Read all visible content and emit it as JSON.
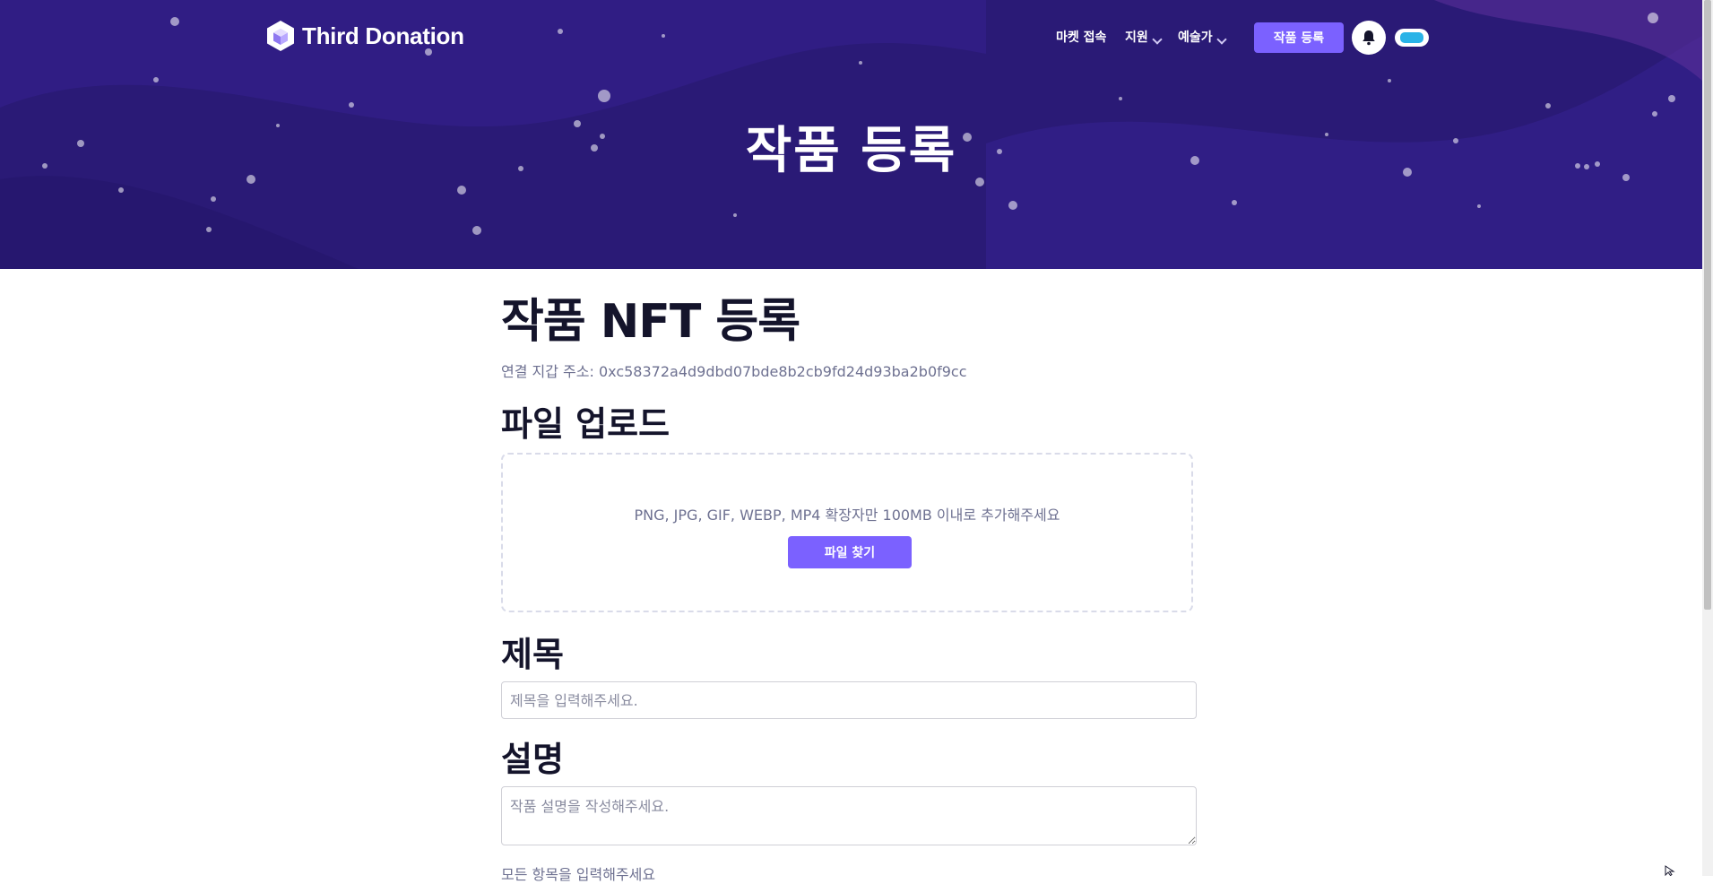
{
  "brand": {
    "name": "Third Donation"
  },
  "nav": {
    "items": [
      {
        "label": "마켓 접속",
        "dropdown": false
      },
      {
        "label": "지원",
        "dropdown": true
      },
      {
        "label": "예술가",
        "dropdown": true
      }
    ],
    "register_button": "작품 등록",
    "bell_icon": "bell-icon",
    "avatar_icon": "user-avatar-icon"
  },
  "hero": {
    "title": "작품 등록"
  },
  "form": {
    "page_title": "작품 NFT 등록",
    "wallet_label": "연결 지갑 주소: 0xc58372a4d9dbd07bde8b2cb9fd24d93ba2b0f9cc",
    "upload": {
      "title": "파일 업로드",
      "hint": "PNG, JPG, GIF, WEBP, MP4 확장자만 100MB 이내로 추가해주세요",
      "button": "파일 찾기"
    },
    "title_field": {
      "label": "제목",
      "value": "",
      "placeholder": "제목을 입력해주세요."
    },
    "description_field": {
      "label": "설명",
      "value": "",
      "placeholder": "작품 설명을 작성해주세요."
    },
    "footnote": "모든 항목을 입력해주세요"
  },
  "colors": {
    "hero_background": "#2c1b78",
    "accent": "#7b61ff",
    "text_dark": "#14142b",
    "text_muted": "#6e7191"
  }
}
